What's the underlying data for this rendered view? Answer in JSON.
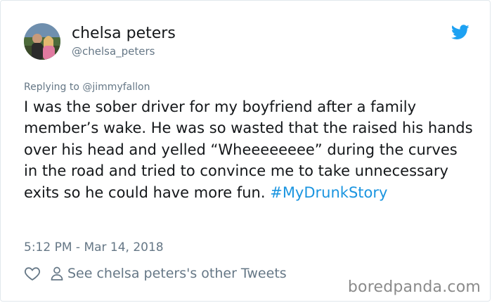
{
  "author": {
    "display_name": "chelsa peters",
    "handle": "@chelsa_peters"
  },
  "icons": {
    "brand": "twitter-bird-icon",
    "like": "heart-icon",
    "profile": "person-icon",
    "brand_color": "#1da1f2",
    "link_color": "#1b95e0",
    "muted_color": "#657786"
  },
  "tweet": {
    "reply_prefix": "Replying to ",
    "reply_to": "@jimmyfallon",
    "text": "I was the sober driver for my boyfriend after a family member’s wake. He was so wasted that the raised his hands over his head and yelled “Wheeeeeeee” during the curves in the road and tried to convince me to take unnecessary exits so he could have more fun. ",
    "hashtag": "#MyDrunkStory",
    "timestamp": "5:12 PM - Mar 14, 2018"
  },
  "actions": {
    "other_tweets_label": "See chelsa peters's other Tweets"
  },
  "watermark": "boredpanda.com"
}
